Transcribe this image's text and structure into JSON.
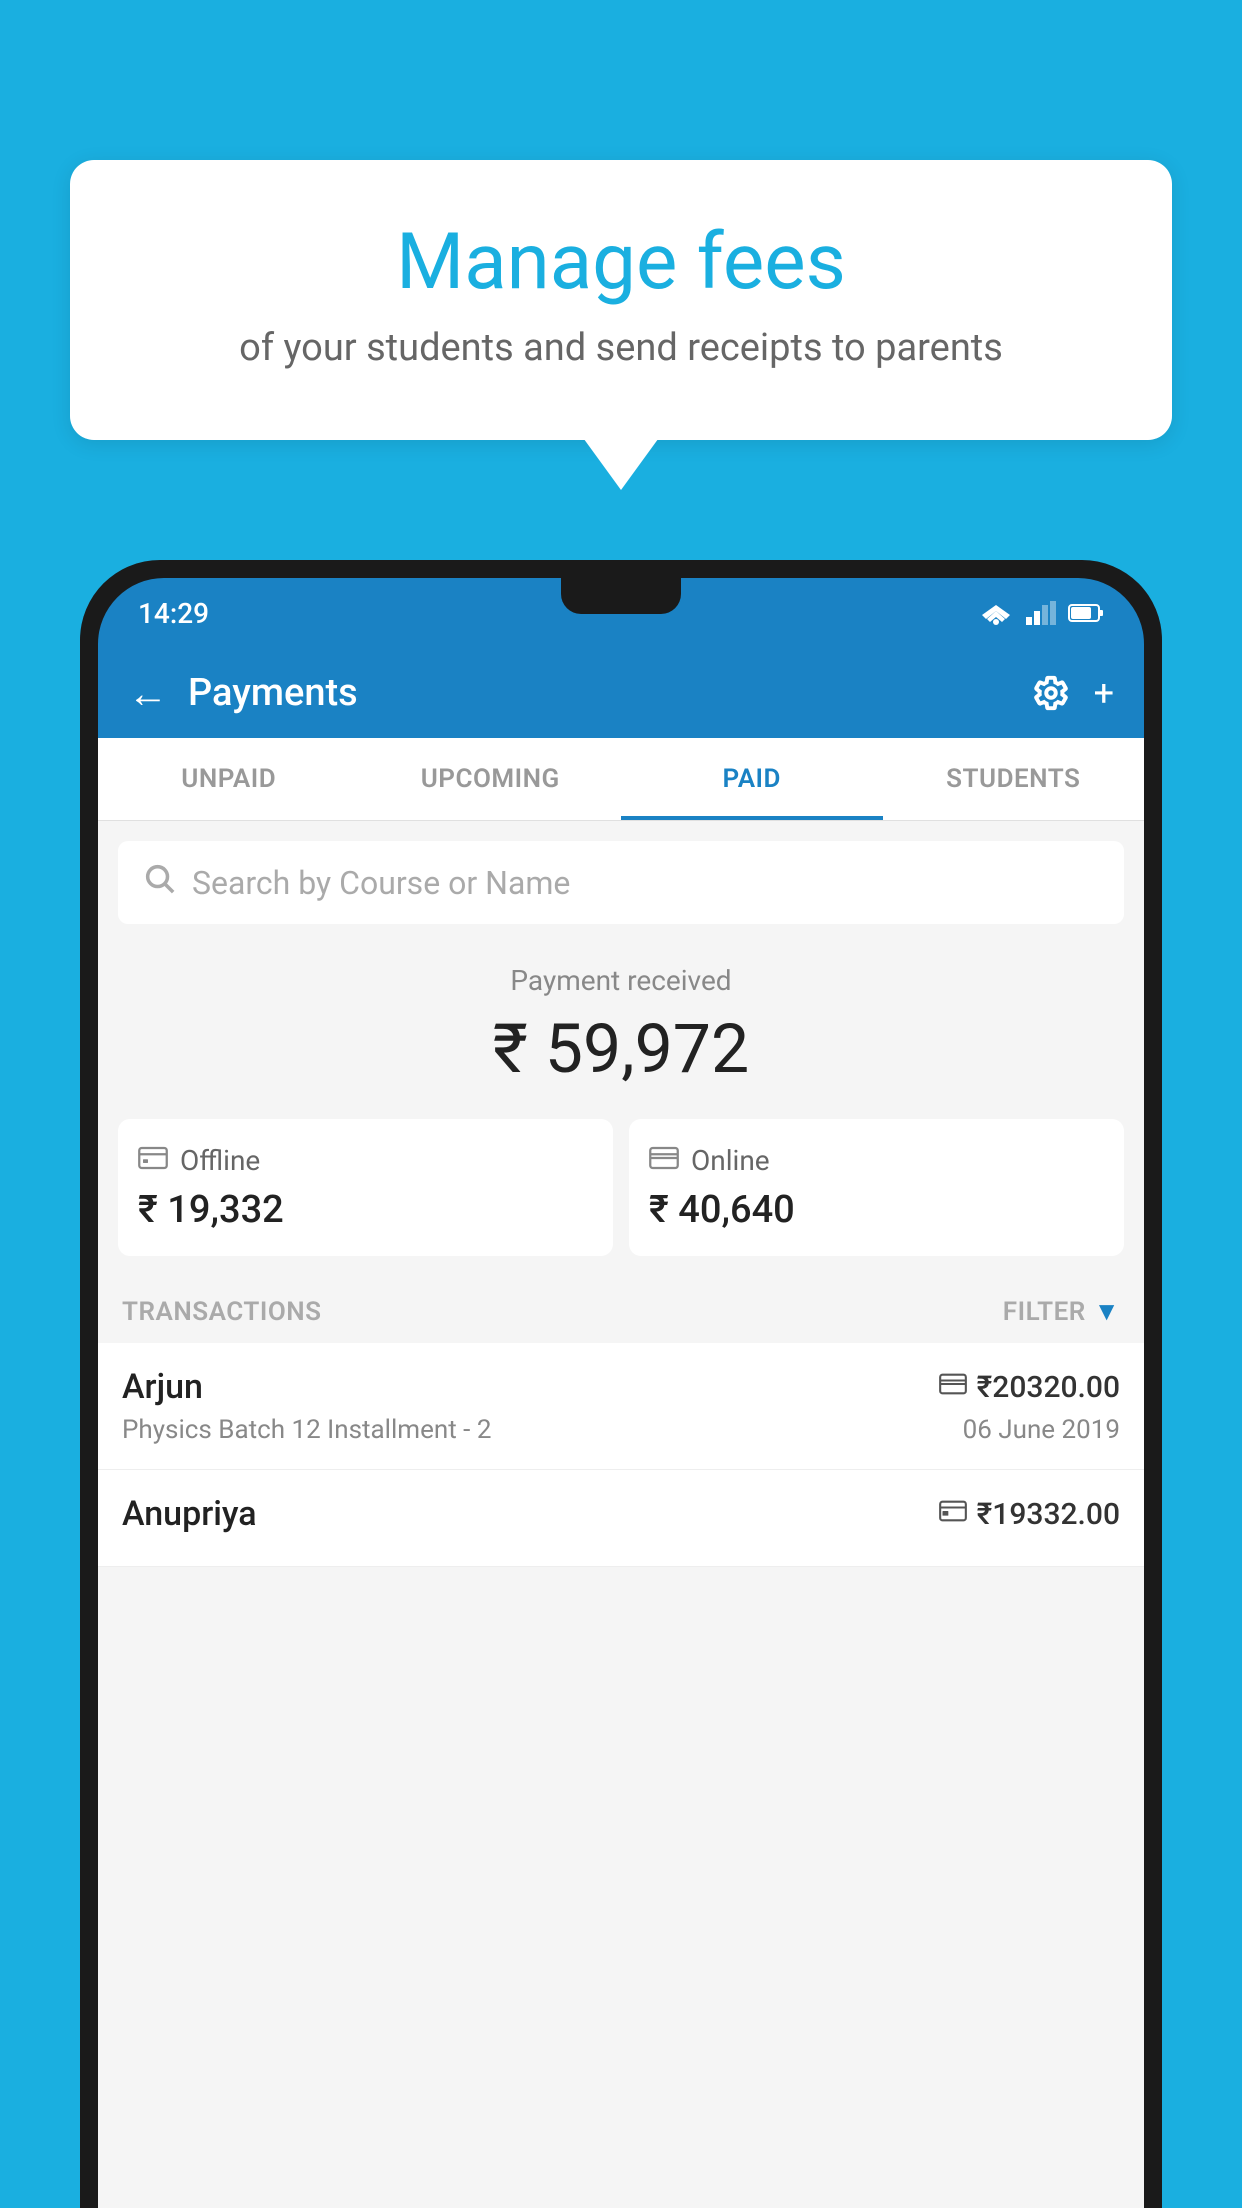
{
  "page": {
    "background_color": "#1AAFE0"
  },
  "speech_bubble": {
    "title": "Manage fees",
    "subtitle": "of your students and send receipts to parents"
  },
  "status_bar": {
    "time": "14:29"
  },
  "app_bar": {
    "title": "Payments",
    "back_icon": "←",
    "plus_icon": "+"
  },
  "tabs": [
    {
      "label": "UNPAID",
      "active": false
    },
    {
      "label": "UPCOMING",
      "active": false
    },
    {
      "label": "PAID",
      "active": true
    },
    {
      "label": "STUDENTS",
      "active": false
    }
  ],
  "search": {
    "placeholder": "Search by Course or Name"
  },
  "payment_summary": {
    "label": "Payment received",
    "amount": "₹ 59,972",
    "offline_label": "Offline",
    "offline_amount": "₹ 19,332",
    "online_label": "Online",
    "online_amount": "₹ 40,640"
  },
  "transactions_section": {
    "header": "TRANSACTIONS",
    "filter_label": "FILTER"
  },
  "transactions": [
    {
      "name": "Arjun",
      "course": "Physics Batch 12 Installment - 2",
      "amount": "₹20320.00",
      "date": "06 June 2019",
      "payment_type": "card"
    },
    {
      "name": "Anupriya",
      "course": "",
      "amount": "₹19332.00",
      "date": "",
      "payment_type": "offline"
    }
  ]
}
